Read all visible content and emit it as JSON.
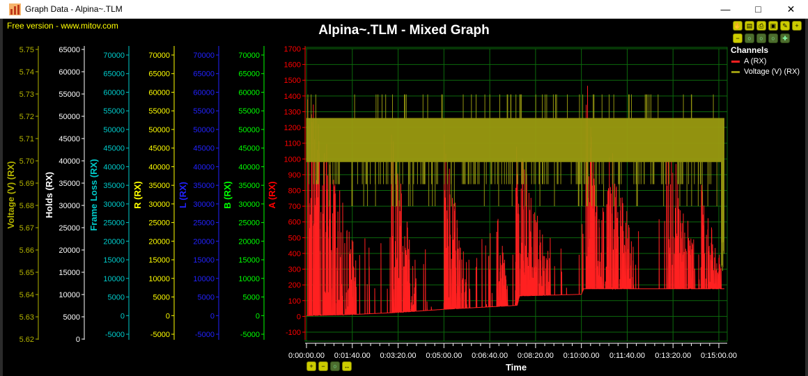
{
  "window": {
    "title": "Graph Data - Alpina~.TLM",
    "minimize_label": "—",
    "maximize_label": "□",
    "close_label": "✕"
  },
  "watermark": "Free version - www.mitov.com",
  "toolbar": {
    "row1": [
      "hand-icon",
      "page-icon",
      "print-icon",
      "save-icon",
      "wrench-icon",
      "zoom-in-icon"
    ],
    "row2": [
      "zoom-out-icon",
      "zoom-reset-icon",
      "zoom-window-icon",
      "zoom-full-icon",
      "pan-icon"
    ]
  },
  "bottom_controls": [
    "zoom-in-icon",
    "zoom-out-icon",
    "zoom-reset-icon",
    "pan-horizontal-icon"
  ],
  "chart_data": {
    "type": "line",
    "title": "Alpina~.TLM - Mixed Graph",
    "xlabel": "Time",
    "x_ticks": [
      "0:00:00.00",
      "0:01:40.00",
      "0:03:20.00",
      "0:05:00.00",
      "0:06:40.00",
      "0:08:20.00",
      "0:10:00.00",
      "0:11:40.00",
      "0:13:20.00",
      "0:15:00.00"
    ],
    "x_range_seconds": [
      0,
      915
    ],
    "legend_title": "Channels",
    "legend_position": "top-right",
    "grid": true,
    "axes": [
      {
        "label": "Voltage (V) (RX)",
        "color": "#b3b300",
        "ticks": [
          "5.75",
          "5.74",
          "5.73",
          "5.72",
          "5.71",
          "5.70",
          "5.69",
          "5.68",
          "5.67",
          "5.66",
          "5.65",
          "5.64",
          "5.63",
          "5.62"
        ],
        "range": [
          5.62,
          5.75
        ]
      },
      {
        "label": "Holds (RX)",
        "color": "#ffffff",
        "ticks": [
          "65000",
          "60000",
          "55000",
          "50000",
          "45000",
          "40000",
          "35000",
          "30000",
          "25000",
          "20000",
          "15000",
          "10000",
          "5000",
          "0"
        ],
        "range": [
          0,
          65000
        ]
      },
      {
        "label": "Frame Loss (RX)",
        "color": "#00cccc",
        "ticks": [
          "70000",
          "65000",
          "60000",
          "55000",
          "50000",
          "45000",
          "40000",
          "35000",
          "30000",
          "25000",
          "20000",
          "15000",
          "10000",
          "5000",
          "0",
          "-5000"
        ],
        "range": [
          -5000,
          70000
        ]
      },
      {
        "label": "R (RX)",
        "color": "#ffff00",
        "ticks": [
          "70000",
          "65000",
          "60000",
          "55000",
          "50000",
          "45000",
          "40000",
          "35000",
          "30000",
          "25000",
          "20000",
          "15000",
          "10000",
          "5000",
          "0",
          "-5000"
        ],
        "range": [
          -5000,
          70000
        ]
      },
      {
        "label": "L (RX)",
        "color": "#2222ff",
        "ticks": [
          "70000",
          "65000",
          "60000",
          "55000",
          "50000",
          "45000",
          "40000",
          "35000",
          "30000",
          "25000",
          "20000",
          "15000",
          "10000",
          "5000",
          "0",
          "-5000"
        ],
        "range": [
          -5000,
          70000
        ]
      },
      {
        "label": "B (RX)",
        "color": "#00ff00",
        "ticks": [
          "70000",
          "65000",
          "60000",
          "55000",
          "50000",
          "45000",
          "40000",
          "35000",
          "30000",
          "25000",
          "20000",
          "15000",
          "10000",
          "5000",
          "0",
          "-5000"
        ],
        "range": [
          -5000,
          70000
        ]
      },
      {
        "label": "A (RX)",
        "color": "#ff0000",
        "ticks": [
          "1700",
          "1600",
          "1500",
          "1400",
          "1300",
          "1200",
          "1100",
          "1000",
          "900",
          "800",
          "700",
          "600",
          "500",
          "400",
          "300",
          "200",
          "100",
          "0",
          "-100"
        ],
        "range": [
          -150,
          1710
        ]
      }
    ],
    "series": [
      {
        "name": "A (RX)",
        "color": "#ff2020",
        "axis": "A (RX)"
      },
      {
        "name": "Voltage (V) (RX)",
        "color": "#9a9a10",
        "axis": "A (RX)"
      }
    ],
    "voltage_band": {
      "low": 980,
      "high": 1260,
      "spike_high": 1410,
      "dips_to": 840
    },
    "a_baseline": [
      {
        "x": 0,
        "y": 5
      },
      {
        "x": 100,
        "y": 12
      },
      {
        "x": 200,
        "y": 25
      },
      {
        "x": 300,
        "y": 45
      },
      {
        "x": 460,
        "y": 70
      },
      {
        "x": 465,
        "y": 130
      },
      {
        "x": 600,
        "y": 140
      },
      {
        "x": 605,
        "y": 175
      },
      {
        "x": 915,
        "y": 175
      }
    ],
    "a_clusters": [
      {
        "x0": 2,
        "x1": 110,
        "peak": 1560
      },
      {
        "x0": 185,
        "x1": 240,
        "peak": 1180
      },
      {
        "x0": 300,
        "x1": 350,
        "peak": 1150
      },
      {
        "x0": 415,
        "x1": 440,
        "peak": 620
      },
      {
        "x0": 455,
        "x1": 530,
        "peak": 1060
      },
      {
        "x0": 610,
        "x1": 655,
        "peak": 1400
      },
      {
        "x0": 655,
        "x1": 715,
        "peak": 1050
      },
      {
        "x0": 785,
        "x1": 845,
        "peak": 1110
      },
      {
        "x0": 860,
        "x1": 905,
        "peak": 690
      }
    ]
  }
}
